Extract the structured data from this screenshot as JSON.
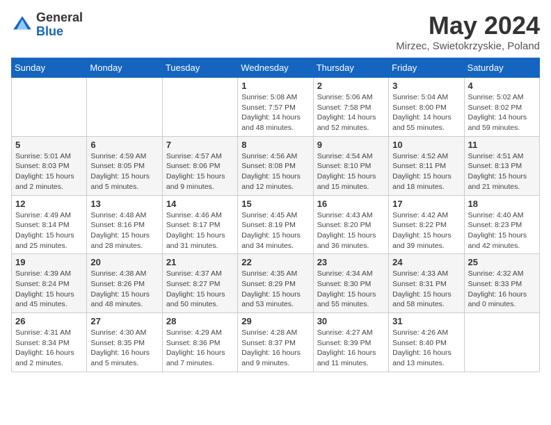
{
  "header": {
    "logo": {
      "line1": "General",
      "line2": "Blue"
    },
    "title": "May 2024",
    "location": "Mirzec, Swietokrzyskie, Poland"
  },
  "weekdays": [
    "Sunday",
    "Monday",
    "Tuesday",
    "Wednesday",
    "Thursday",
    "Friday",
    "Saturday"
  ],
  "weeks": [
    [
      {
        "day": "",
        "info": ""
      },
      {
        "day": "",
        "info": ""
      },
      {
        "day": "",
        "info": ""
      },
      {
        "day": "1",
        "info": "Sunrise: 5:08 AM\nSunset: 7:57 PM\nDaylight: 14 hours and 48 minutes."
      },
      {
        "day": "2",
        "info": "Sunrise: 5:06 AM\nSunset: 7:58 PM\nDaylight: 14 hours and 52 minutes."
      },
      {
        "day": "3",
        "info": "Sunrise: 5:04 AM\nSunset: 8:00 PM\nDaylight: 14 hours and 55 minutes."
      },
      {
        "day": "4",
        "info": "Sunrise: 5:02 AM\nSunset: 8:02 PM\nDaylight: 14 hours and 59 minutes."
      }
    ],
    [
      {
        "day": "5",
        "info": "Sunrise: 5:01 AM\nSunset: 8:03 PM\nDaylight: 15 hours and 2 minutes."
      },
      {
        "day": "6",
        "info": "Sunrise: 4:59 AM\nSunset: 8:05 PM\nDaylight: 15 hours and 5 minutes."
      },
      {
        "day": "7",
        "info": "Sunrise: 4:57 AM\nSunset: 8:06 PM\nDaylight: 15 hours and 9 minutes."
      },
      {
        "day": "8",
        "info": "Sunrise: 4:56 AM\nSunset: 8:08 PM\nDaylight: 15 hours and 12 minutes."
      },
      {
        "day": "9",
        "info": "Sunrise: 4:54 AM\nSunset: 8:10 PM\nDaylight: 15 hours and 15 minutes."
      },
      {
        "day": "10",
        "info": "Sunrise: 4:52 AM\nSunset: 8:11 PM\nDaylight: 15 hours and 18 minutes."
      },
      {
        "day": "11",
        "info": "Sunrise: 4:51 AM\nSunset: 8:13 PM\nDaylight: 15 hours and 21 minutes."
      }
    ],
    [
      {
        "day": "12",
        "info": "Sunrise: 4:49 AM\nSunset: 8:14 PM\nDaylight: 15 hours and 25 minutes."
      },
      {
        "day": "13",
        "info": "Sunrise: 4:48 AM\nSunset: 8:16 PM\nDaylight: 15 hours and 28 minutes."
      },
      {
        "day": "14",
        "info": "Sunrise: 4:46 AM\nSunset: 8:17 PM\nDaylight: 15 hours and 31 minutes."
      },
      {
        "day": "15",
        "info": "Sunrise: 4:45 AM\nSunset: 8:19 PM\nDaylight: 15 hours and 34 minutes."
      },
      {
        "day": "16",
        "info": "Sunrise: 4:43 AM\nSunset: 8:20 PM\nDaylight: 15 hours and 36 minutes."
      },
      {
        "day": "17",
        "info": "Sunrise: 4:42 AM\nSunset: 8:22 PM\nDaylight: 15 hours and 39 minutes."
      },
      {
        "day": "18",
        "info": "Sunrise: 4:40 AM\nSunset: 8:23 PM\nDaylight: 15 hours and 42 minutes."
      }
    ],
    [
      {
        "day": "19",
        "info": "Sunrise: 4:39 AM\nSunset: 8:24 PM\nDaylight: 15 hours and 45 minutes."
      },
      {
        "day": "20",
        "info": "Sunrise: 4:38 AM\nSunset: 8:26 PM\nDaylight: 15 hours and 48 minutes."
      },
      {
        "day": "21",
        "info": "Sunrise: 4:37 AM\nSunset: 8:27 PM\nDaylight: 15 hours and 50 minutes."
      },
      {
        "day": "22",
        "info": "Sunrise: 4:35 AM\nSunset: 8:29 PM\nDaylight: 15 hours and 53 minutes."
      },
      {
        "day": "23",
        "info": "Sunrise: 4:34 AM\nSunset: 8:30 PM\nDaylight: 15 hours and 55 minutes."
      },
      {
        "day": "24",
        "info": "Sunrise: 4:33 AM\nSunset: 8:31 PM\nDaylight: 15 hours and 58 minutes."
      },
      {
        "day": "25",
        "info": "Sunrise: 4:32 AM\nSunset: 8:33 PM\nDaylight: 16 hours and 0 minutes."
      }
    ],
    [
      {
        "day": "26",
        "info": "Sunrise: 4:31 AM\nSunset: 8:34 PM\nDaylight: 16 hours and 2 minutes."
      },
      {
        "day": "27",
        "info": "Sunrise: 4:30 AM\nSunset: 8:35 PM\nDaylight: 16 hours and 5 minutes."
      },
      {
        "day": "28",
        "info": "Sunrise: 4:29 AM\nSunset: 8:36 PM\nDaylight: 16 hours and 7 minutes."
      },
      {
        "day": "29",
        "info": "Sunrise: 4:28 AM\nSunset: 8:37 PM\nDaylight: 16 hours and 9 minutes."
      },
      {
        "day": "30",
        "info": "Sunrise: 4:27 AM\nSunset: 8:39 PM\nDaylight: 16 hours and 11 minutes."
      },
      {
        "day": "31",
        "info": "Sunrise: 4:26 AM\nSunset: 8:40 PM\nDaylight: 16 hours and 13 minutes."
      },
      {
        "day": "",
        "info": ""
      }
    ]
  ]
}
